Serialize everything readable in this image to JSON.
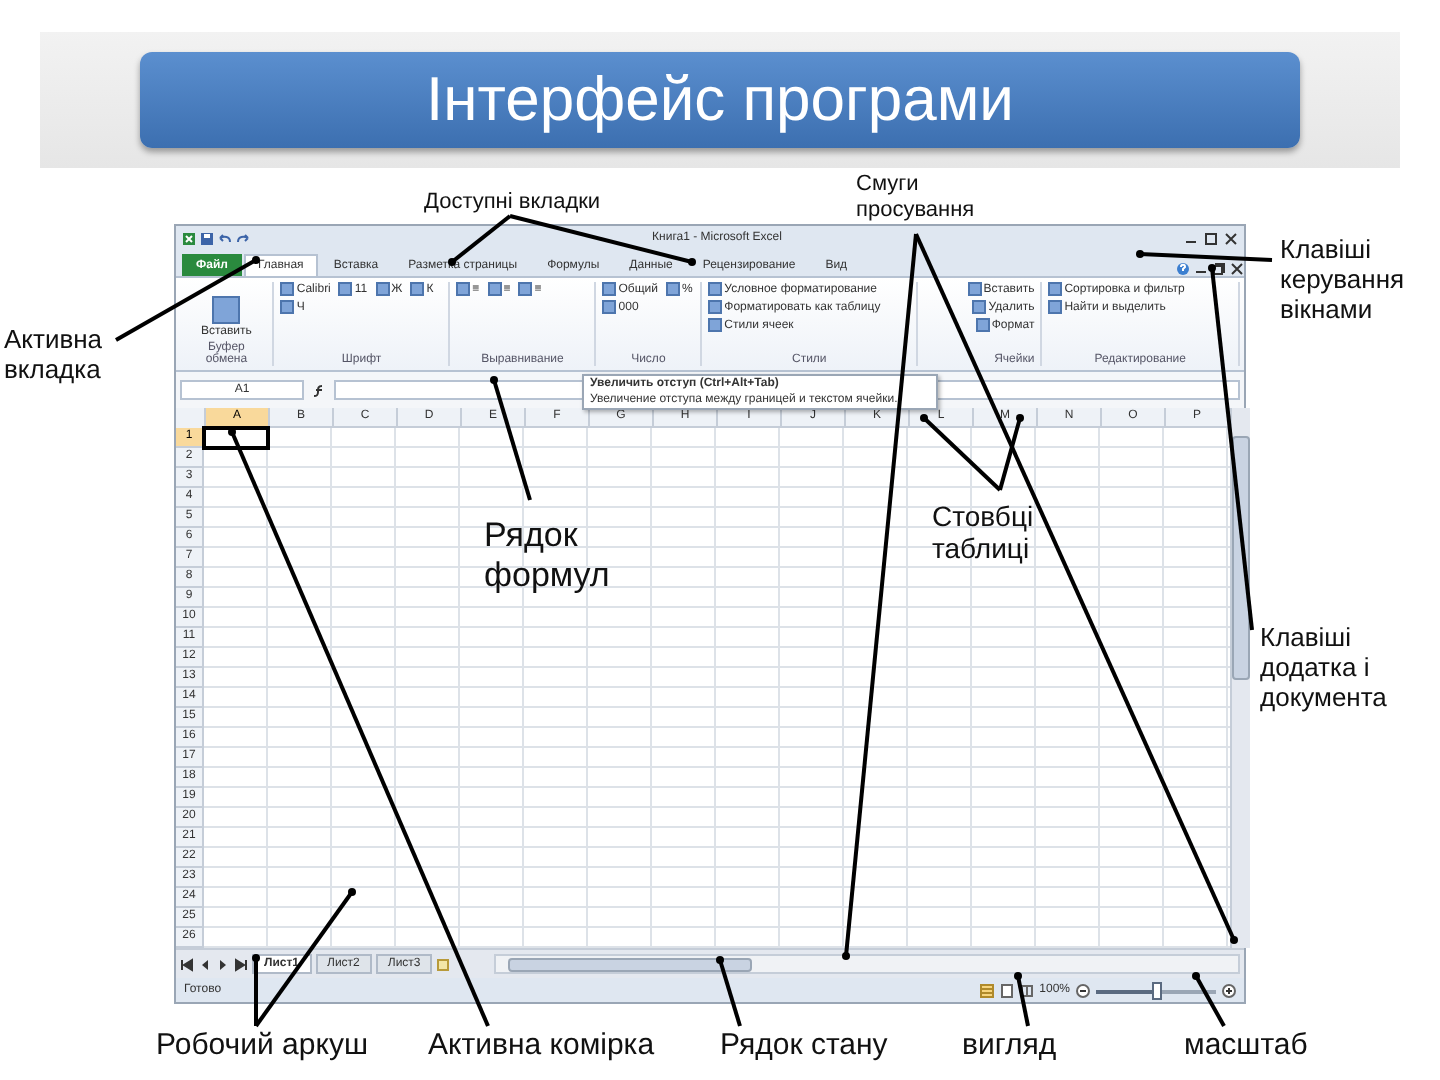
{
  "slide": {
    "title": "Інтерфейс програми"
  },
  "excel": {
    "window_title": "Книга1 - Microsoft Excel",
    "tabs": [
      {
        "label": "Файл",
        "kind": "file",
        "selected": false
      },
      {
        "label": "Главная",
        "kind": "tab",
        "selected": true
      },
      {
        "label": "Вставка",
        "kind": "tab",
        "selected": false
      },
      {
        "label": "Разметка страницы",
        "kind": "tab",
        "selected": false
      },
      {
        "label": "Формулы",
        "kind": "tab",
        "selected": false
      },
      {
        "label": "Данные",
        "kind": "tab",
        "selected": false
      },
      {
        "label": "Рецензирование",
        "kind": "tab",
        "selected": false
      },
      {
        "label": "Вид",
        "kind": "tab",
        "selected": false
      }
    ],
    "ribbon_groups": [
      {
        "label": "Буфер обмена",
        "items": [
          "Вставить"
        ]
      },
      {
        "label": "Шрифт",
        "items": [
          "Calibri",
          "11",
          "Ж",
          "К",
          "Ч"
        ]
      },
      {
        "label": "Выравнивание",
        "items": [
          "≡",
          "≡",
          "≡"
        ]
      },
      {
        "label": "Число",
        "items": [
          "Общий",
          "%",
          "000"
        ]
      },
      {
        "label": "Стили",
        "items": [
          "Условное форматирование",
          "Форматировать как таблицу",
          "Стили ячеек"
        ]
      },
      {
        "label": "Ячейки",
        "items": [
          "Вставить",
          "Удалить",
          "Формат"
        ]
      },
      {
        "label": "Редактирование",
        "items": [
          "Сортировка и фильтр",
          "Найти и выделить"
        ]
      }
    ],
    "name_box": "A1",
    "tooltip": {
      "title": "Увеличить отступ (Ctrl+Alt+Tab)",
      "text": "Увеличение отступа между границей и текстом ячейки."
    },
    "columns": [
      {
        "label": "A",
        "selected": true
      },
      {
        "label": "B",
        "selected": false
      },
      {
        "label": "C",
        "selected": false
      },
      {
        "label": "D",
        "selected": false
      },
      {
        "label": "E",
        "selected": false
      },
      {
        "label": "F",
        "selected": false
      },
      {
        "label": "G",
        "selected": false
      },
      {
        "label": "H",
        "selected": false
      },
      {
        "label": "I",
        "selected": false
      },
      {
        "label": "J",
        "selected": false
      },
      {
        "label": "K",
        "selected": false
      },
      {
        "label": "L",
        "selected": false
      },
      {
        "label": "M",
        "selected": false
      },
      {
        "label": "N",
        "selected": false
      },
      {
        "label": "O",
        "selected": false
      },
      {
        "label": "P",
        "selected": false
      }
    ],
    "rows": [
      {
        "label": "1",
        "selected": true
      },
      {
        "label": "2",
        "selected": false
      },
      {
        "label": "3",
        "selected": false
      },
      {
        "label": "4",
        "selected": false
      },
      {
        "label": "5",
        "selected": false
      },
      {
        "label": "6",
        "selected": false
      },
      {
        "label": "7",
        "selected": false
      },
      {
        "label": "8",
        "selected": false
      },
      {
        "label": "9",
        "selected": false
      },
      {
        "label": "10",
        "selected": false
      },
      {
        "label": "11",
        "selected": false
      },
      {
        "label": "12",
        "selected": false
      },
      {
        "label": "13",
        "selected": false
      },
      {
        "label": "14",
        "selected": false
      },
      {
        "label": "15",
        "selected": false
      },
      {
        "label": "16",
        "selected": false
      },
      {
        "label": "17",
        "selected": false
      },
      {
        "label": "18",
        "selected": false
      },
      {
        "label": "19",
        "selected": false
      },
      {
        "label": "20",
        "selected": false
      },
      {
        "label": "21",
        "selected": false
      },
      {
        "label": "22",
        "selected": false
      },
      {
        "label": "23",
        "selected": false
      },
      {
        "label": "24",
        "selected": false
      },
      {
        "label": "25",
        "selected": false
      },
      {
        "label": "26",
        "selected": false
      }
    ],
    "sheets": [
      {
        "label": "Лист1",
        "selected": true
      },
      {
        "label": "Лист2",
        "selected": false
      },
      {
        "label": "Лист3",
        "selected": false
      }
    ],
    "status": "Готово",
    "zoom": {
      "reading": "100%",
      "level": 0.5
    }
  },
  "callouts": [
    {
      "text": "Доступні вкладки"
    },
    {
      "text": "Смуги просування"
    },
    {
      "text": "Клавіші керування вікнами"
    },
    {
      "text": "Активна вкладка"
    },
    {
      "text": "Рядок формул"
    },
    {
      "text": "Стовбці таблиці"
    },
    {
      "text": "Клавіші додатка і документа"
    },
    {
      "text": "Робочий аркуш"
    },
    {
      "text": "Активна комірка"
    },
    {
      "text": "Рядок стану"
    },
    {
      "text": "вигляд"
    },
    {
      "text": "масштаб"
    }
  ]
}
